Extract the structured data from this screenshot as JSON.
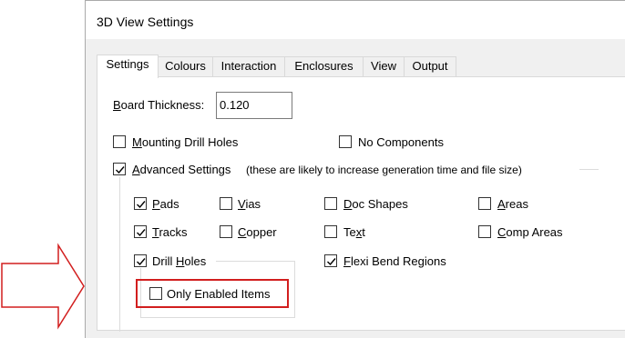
{
  "window": {
    "title": "3D View Settings"
  },
  "tabs": [
    {
      "label": "Settings",
      "active": true
    },
    {
      "label": "Colours",
      "active": false
    },
    {
      "label": "Interaction",
      "active": false
    },
    {
      "label": "Enclosures",
      "active": false
    },
    {
      "label": "View",
      "active": false
    },
    {
      "label": "Output",
      "active": false
    }
  ],
  "board_thickness": {
    "label_u": "B",
    "label_rest": "oard Thickness:",
    "value": "0.120"
  },
  "options": {
    "mounting_drill_holes": {
      "u": "M",
      "rest": "ounting Drill Holes",
      "checked": false
    },
    "no_components": {
      "label": "No Components",
      "checked": false
    },
    "advanced_settings": {
      "u": "A",
      "rest": "dvanced Settings",
      "note": "(these are likely to increase generation time and file size)",
      "checked": true
    },
    "pads": {
      "u": "P",
      "rest": "ads",
      "checked": true
    },
    "vias": {
      "u": "V",
      "rest": "ias",
      "checked": false
    },
    "doc_shapes": {
      "u": "D",
      "rest": "oc Shapes",
      "checked": false
    },
    "areas": {
      "u": "A",
      "rest": "reas",
      "checked": false
    },
    "tracks": {
      "u": "T",
      "rest": "racks",
      "checked": true
    },
    "copper": {
      "u": "C",
      "rest": "opper",
      "checked": false
    },
    "text": {
      "pre": "Te",
      "u": "x",
      "rest": "t",
      "checked": false
    },
    "comp_areas": {
      "u": "C",
      "rest": "omp Areas",
      "checked": false
    },
    "drill_holes": {
      "pre": "Drill ",
      "u": "H",
      "rest": "oles",
      "checked": true
    },
    "flexi_bend_regions": {
      "u": "F",
      "rest": "lexi Bend Regions",
      "checked": true
    },
    "only_enabled_items": {
      "label": "Only Enabled Items",
      "checked": false
    }
  },
  "colors": {
    "highlight": "#d21e1e",
    "arrow": "#d21e1e"
  }
}
